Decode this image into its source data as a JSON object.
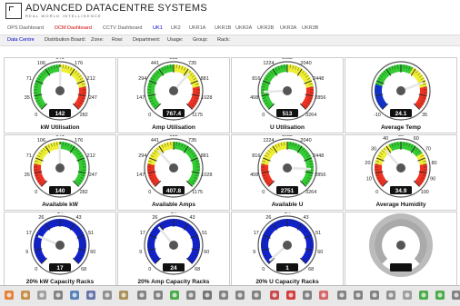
{
  "header": {
    "brand": "ADVANCED DATACENTRE SYSTEMS",
    "tagline": "REAL WORLD INTELLIGENCE"
  },
  "nav_tabs": [
    {
      "label": "OPS Dashboard",
      "state": "normal"
    },
    {
      "label": "DCM Dashboard",
      "state": "active"
    },
    {
      "label": "CCTV Dashboard",
      "state": "normal"
    },
    {
      "label": "UK1",
      "state": "selected"
    },
    {
      "label": "UK2",
      "state": "normal"
    },
    {
      "label": "UKR1A",
      "state": "normal"
    },
    {
      "label": "UKR1B",
      "state": "normal"
    },
    {
      "label": "UKR2A",
      "state": "normal"
    },
    {
      "label": "UKR2B",
      "state": "normal"
    },
    {
      "label": "UKR3A",
      "state": "normal"
    },
    {
      "label": "UKR3B",
      "state": "normal"
    }
  ],
  "filters": [
    {
      "label": "Data Centre",
      "state": "active"
    },
    {
      "label": "Distribution Board",
      "state": "normal"
    },
    {
      "label": "Zone",
      "state": "normal"
    },
    {
      "label": "Row",
      "state": "normal"
    },
    {
      "label": "Department",
      "state": "normal"
    },
    {
      "label": "Usage",
      "state": "normal"
    },
    {
      "label": "Group",
      "state": "normal"
    },
    {
      "label": "Rack",
      "state": "normal"
    }
  ],
  "gauges": [
    {
      "title": "kW Utilisation",
      "value_text": "142",
      "value": 142,
      "min": 0,
      "max": 282,
      "ticks": [
        "0",
        "35",
        "71",
        "106",
        "141",
        "176",
        "212",
        "247",
        "282"
      ],
      "bands": [
        {
          "from": 0,
          "to": 0.5,
          "color": "#33cc33"
        },
        {
          "from": 0.5,
          "to": 0.8,
          "color": "#eeee33"
        },
        {
          "from": 0.8,
          "to": 1,
          "color": "#ee3322"
        }
      ]
    },
    {
      "title": "Amp Utilisation",
      "value_text": "767.4",
      "value": 767.4,
      "min": 0,
      "max": 1175,
      "ticks": [
        "0",
        "147",
        "294",
        "441",
        "588",
        "735",
        "881",
        "1028",
        "1175"
      ],
      "bands": [
        {
          "from": 0,
          "to": 0.5,
          "color": "#33cc33"
        },
        {
          "from": 0.5,
          "to": 0.8,
          "color": "#eeee33"
        },
        {
          "from": 0.8,
          "to": 1,
          "color": "#ee3322"
        }
      ]
    },
    {
      "title": "U Utilisation",
      "value_text": "513",
      "value": 513,
      "min": 0,
      "max": 3264,
      "ticks": [
        "0",
        "408",
        "816",
        "1224",
        "1632",
        "2040",
        "2448",
        "2856",
        "3264"
      ],
      "bands": [
        {
          "from": 0,
          "to": 0.5,
          "color": "#33cc33"
        },
        {
          "from": 0.5,
          "to": 0.8,
          "color": "#eeee33"
        },
        {
          "from": 0.8,
          "to": 1,
          "color": "#ee3322"
        }
      ]
    },
    {
      "title": "Average Temp",
      "value_text": "24.1",
      "value": 24.1,
      "min": -10,
      "max": 35,
      "ticks": [
        "-10",
        "35"
      ],
      "bands": [
        {
          "from": 0,
          "to": 0.22,
          "color": "#1133cc"
        },
        {
          "from": 0.22,
          "to": 0.6,
          "color": "#33cc33"
        },
        {
          "from": 0.6,
          "to": 0.8,
          "color": "#eeee33"
        },
        {
          "from": 0.8,
          "to": 1,
          "color": "#ee3322"
        }
      ]
    },
    {
      "title": "Available kW",
      "value_text": "140",
      "value": 140,
      "min": 0,
      "max": 282,
      "ticks": [
        "0",
        "35",
        "71",
        "106",
        "141",
        "176",
        "212",
        "247",
        "282"
      ],
      "bands": [
        {
          "from": 0,
          "to": 0.2,
          "color": "#ee3322"
        },
        {
          "from": 0.2,
          "to": 0.5,
          "color": "#eeee33"
        },
        {
          "from": 0.5,
          "to": 1,
          "color": "#33cc33"
        }
      ]
    },
    {
      "title": "Available Amps",
      "value_text": "407.8",
      "value": 407.8,
      "min": 0,
      "max": 1175,
      "ticks": [
        "0",
        "147",
        "294",
        "441",
        "588",
        "735",
        "881",
        "1028",
        "1175"
      ],
      "bands": [
        {
          "from": 0,
          "to": 0.2,
          "color": "#ee3322"
        },
        {
          "from": 0.2,
          "to": 0.5,
          "color": "#eeee33"
        },
        {
          "from": 0.5,
          "to": 1,
          "color": "#33cc33"
        }
      ]
    },
    {
      "title": "Available U",
      "value_text": "2751",
      "value": 2751,
      "min": 0,
      "max": 3264,
      "ticks": [
        "0",
        "408",
        "816",
        "1224",
        "1632",
        "2040",
        "2448",
        "2856",
        "3264"
      ],
      "bands": [
        {
          "from": 0,
          "to": 0.2,
          "color": "#ee3322"
        },
        {
          "from": 0.2,
          "to": 0.5,
          "color": "#eeee33"
        },
        {
          "from": 0.5,
          "to": 1,
          "color": "#33cc33"
        }
      ]
    },
    {
      "title": "Average Humidity",
      "value_text": "34.9",
      "value": 34.9,
      "min": 0,
      "max": 100,
      "ticks": [
        "0",
        "10",
        "20",
        "30",
        "40",
        "50",
        "60",
        "70",
        "80",
        "90",
        "100"
      ],
      "bands": [
        {
          "from": 0,
          "to": 0.2,
          "color": "#ee3322"
        },
        {
          "from": 0.2,
          "to": 0.4,
          "color": "#eeee33"
        },
        {
          "from": 0.4,
          "to": 0.7,
          "color": "#33cc33"
        },
        {
          "from": 0.7,
          "to": 0.8,
          "color": "#eeee33"
        },
        {
          "from": 0.8,
          "to": 1,
          "color": "#ee3322"
        }
      ]
    },
    {
      "title": "20% kW Capacity Racks",
      "value_text": "17",
      "value": 17,
      "min": 0,
      "max": 68,
      "ticks": [
        "0",
        "9",
        "17",
        "26",
        "34",
        "43",
        "51",
        "60",
        "68"
      ],
      "bands": [
        {
          "from": 0,
          "to": 1,
          "color": "#1122cc"
        }
      ]
    },
    {
      "title": "20% Amp Capacity Racks",
      "value_text": "24",
      "value": 24,
      "min": 0,
      "max": 68,
      "ticks": [
        "0",
        "9",
        "17",
        "26",
        "34",
        "43",
        "51",
        "60",
        "68"
      ],
      "bands": [
        {
          "from": 0,
          "to": 1,
          "color": "#1122cc"
        }
      ]
    },
    {
      "title": "20% U Capacity Racks",
      "value_text": "1",
      "value": 1,
      "min": 0,
      "max": 68,
      "ticks": [
        "0",
        "9",
        "17",
        "26",
        "34",
        "43",
        "51",
        "60",
        "68"
      ],
      "bands": [
        {
          "from": 0,
          "to": 1,
          "color": "#1122cc"
        }
      ]
    },
    {
      "title": "",
      "value_text": "",
      "value": 0,
      "min": 0,
      "max": 1,
      "ticks": [],
      "bands": [
        {
          "from": 0,
          "to": 1,
          "color": "#aaaaaa"
        }
      ]
    }
  ],
  "toolbar_icons": [
    "chart-icon",
    "folder-icon",
    "lock-icon",
    "zoom-icon",
    "calendar-icon",
    "users-icon",
    "grid-icon",
    "edit-icon",
    "back-icon",
    "forward-icon",
    "refresh-icon",
    "zoom-icon",
    "search-icon",
    "zoom-out-icon",
    "zoom-in-icon",
    "list-icon",
    "home-icon",
    "stop-icon",
    "expand-icon",
    "flag-icon",
    "alert-icon",
    "help-icon",
    "tools-icon",
    "wrench-icon",
    "key-icon",
    "exit-icon",
    "refresh-icon",
    "gear-icon"
  ],
  "colors": {
    "active_tab": "#cc0000",
    "selected_tab": "#0000cc",
    "needle": "#cccccc",
    "value_box": "#111111"
  }
}
